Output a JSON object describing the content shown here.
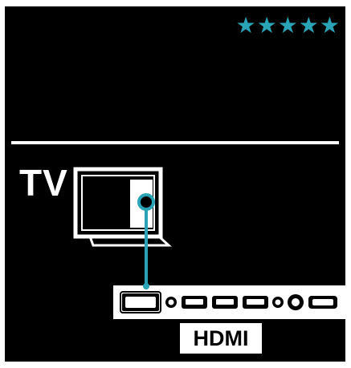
{
  "rating": {
    "stars": "★★★★★",
    "level": 5,
    "max": 5
  },
  "tv": {
    "label": "TV"
  },
  "connector": {
    "label": "HDMI"
  },
  "colors": {
    "background": "#000000",
    "accent": "#2aa3b6",
    "line": "#ffffff"
  },
  "icons": [
    "star-icon",
    "tv-icon",
    "hdmi-cable-icon",
    "device-port-panel-icon"
  ]
}
